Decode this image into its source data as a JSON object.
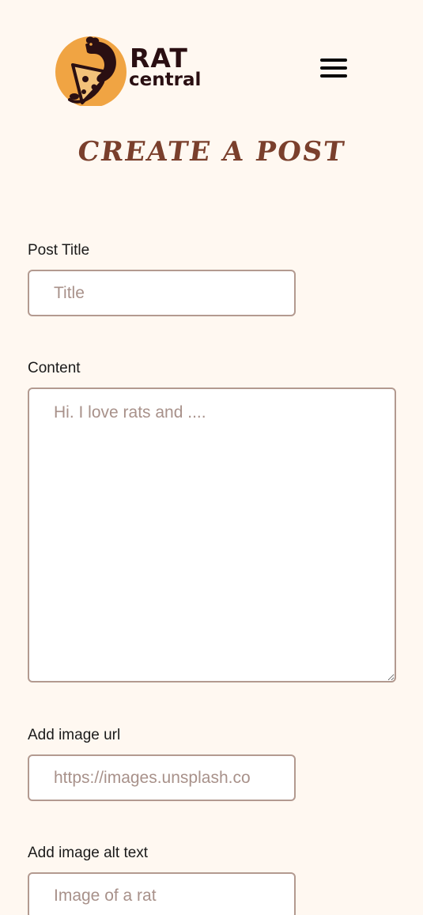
{
  "brand": {
    "name_line1": "RAT",
    "name_line2": "central"
  },
  "page": {
    "title": "CREATE A POST"
  },
  "form": {
    "title_label": "Post Title",
    "title_placeholder": "Title",
    "content_label": "Content",
    "content_placeholder": "Hi. I love rats and ....",
    "image_url_label": "Add image url",
    "image_url_placeholder": "https://images.unsplash.co",
    "image_alt_label": "Add image alt text",
    "image_alt_placeholder": "Image of a rat"
  },
  "colors": {
    "background": "#fff8f1",
    "title": "#7a3f2c",
    "brand_dark": "#2a0f12",
    "logo_orange": "#f0a443",
    "input_border": "#b39a90",
    "placeholder": "#a8918a"
  },
  "icons": {
    "logo": "rat-on-pizza-logo-icon",
    "menu": "hamburger-menu-icon"
  }
}
